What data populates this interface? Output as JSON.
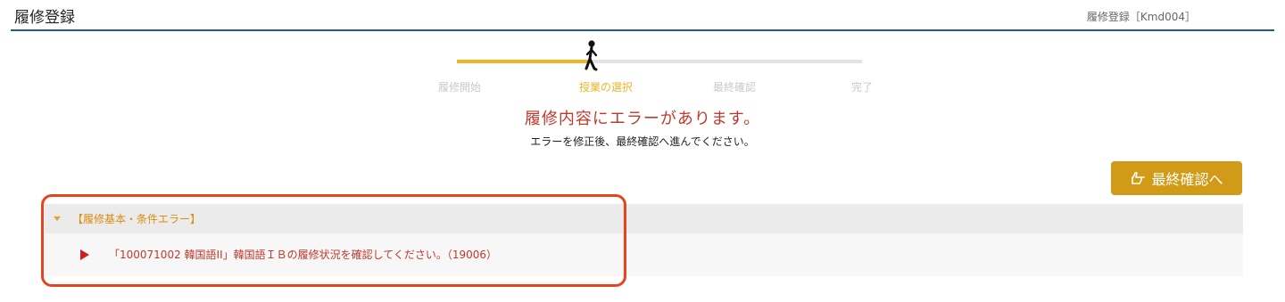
{
  "header": {
    "title": "履修登録",
    "screen_id": "履修登録［Kmd004］"
  },
  "stepper": {
    "steps": [
      {
        "label": "履修開始",
        "active": false
      },
      {
        "label": "授業の選択",
        "active": true
      },
      {
        "label": "最終確認",
        "active": false
      },
      {
        "label": "完了",
        "active": false
      }
    ],
    "progress": 0.33,
    "walker_icon": "walking-person-icon"
  },
  "message": {
    "title": "履修内容にエラーがあります。",
    "subtitle": "エラーを修正後、最終確認へ進んでください。"
  },
  "actions": {
    "final_confirm_label": "最終確認へ",
    "final_confirm_icon": "pointing-hand-icon"
  },
  "error_panel": {
    "title": "【履修基本・条件エラー】",
    "expanded": true,
    "items": [
      "「100071002 韓国語II」韓国語ＩＢの履修状況を確認してください。（19006）"
    ]
  },
  "colors": {
    "accent": "#f0b429",
    "button": "#d19a17",
    "error": "#c0392b",
    "header_rule": "#1f5c86",
    "highlight": "#e8431f"
  }
}
